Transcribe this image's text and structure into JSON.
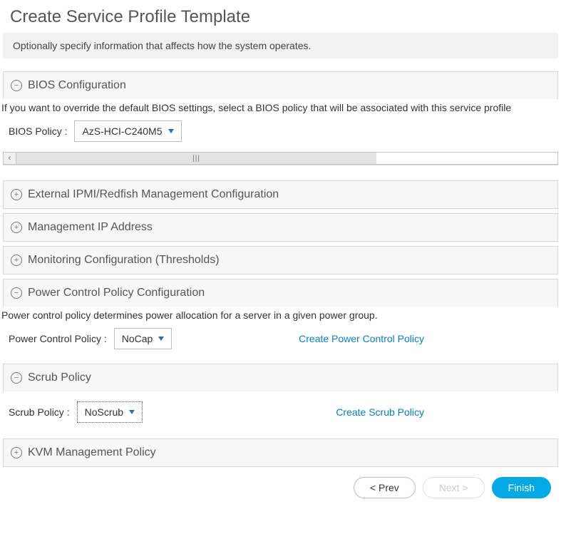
{
  "page_title": "Create Service Profile Template",
  "info_banner": "Optionally specify information that affects how the system operates.",
  "sections": {
    "bios": {
      "title": "BIOS Configuration",
      "desc": "If you want to override the default BIOS settings, select a BIOS policy that will be associated with this service profile",
      "field_label": "BIOS Policy :",
      "field_value": "AzS-HCI-C240M5"
    },
    "ipmi": {
      "title": "External IPMI/Redfish Management Configuration"
    },
    "mgmt_ip": {
      "title": "Management IP Address"
    },
    "monitoring": {
      "title": "Monitoring Configuration (Thresholds)"
    },
    "power": {
      "title": "Power Control Policy Configuration",
      "desc": "Power control policy determines power allocation for a server in a given power group.",
      "field_label": "Power Control Policy :",
      "field_value": "NoCap",
      "link": "Create Power Control Policy"
    },
    "scrub": {
      "title": "Scrub Policy",
      "field_label": "Scrub Policy :",
      "field_value": "NoScrub",
      "link": "Create Scrub Policy"
    },
    "kvm": {
      "title": "KVM Management Policy"
    }
  },
  "footer": {
    "prev": "< Prev",
    "next": "Next >",
    "finish": "Finish"
  }
}
